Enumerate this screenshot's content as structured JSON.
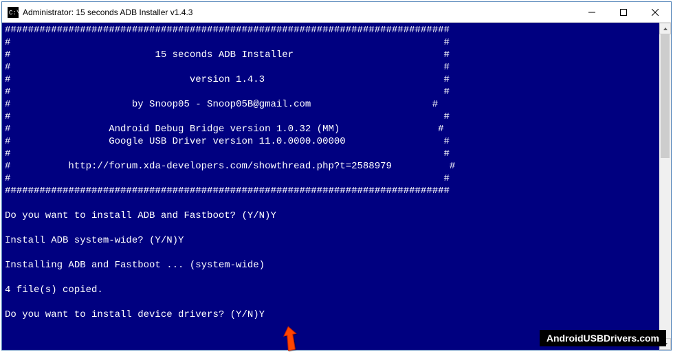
{
  "window": {
    "title": "Administrator:  15 seconds ADB Installer v1.4.3"
  },
  "banner": {
    "border_char": "#",
    "title": "15 seconds ADB Installer",
    "version": "version 1.4.3",
    "author": "by Snoop05 - Snoop05B@gmail.com",
    "adb_version": "Android Debug Bridge version 1.0.32 (MM)",
    "driver_version": "Google USB Driver version 11.0.0000.00000",
    "forum_url": "http://forum.xda-developers.com/showthread.php?t=2588979"
  },
  "prompts": {
    "q1": "Do you want to install ADB and Fastboot? (Y/N)",
    "a1": "Y",
    "q2": "Install ADB system-wide? (Y/N)",
    "a2": "Y",
    "status": "Installing ADB and Fastboot ... (system-wide)",
    "copied": "4 file(s) copied.",
    "q3": "Do you want to install device drivers? (Y/N)",
    "a3": "Y"
  },
  "watermark": "AndroidUSBDrivers.com"
}
